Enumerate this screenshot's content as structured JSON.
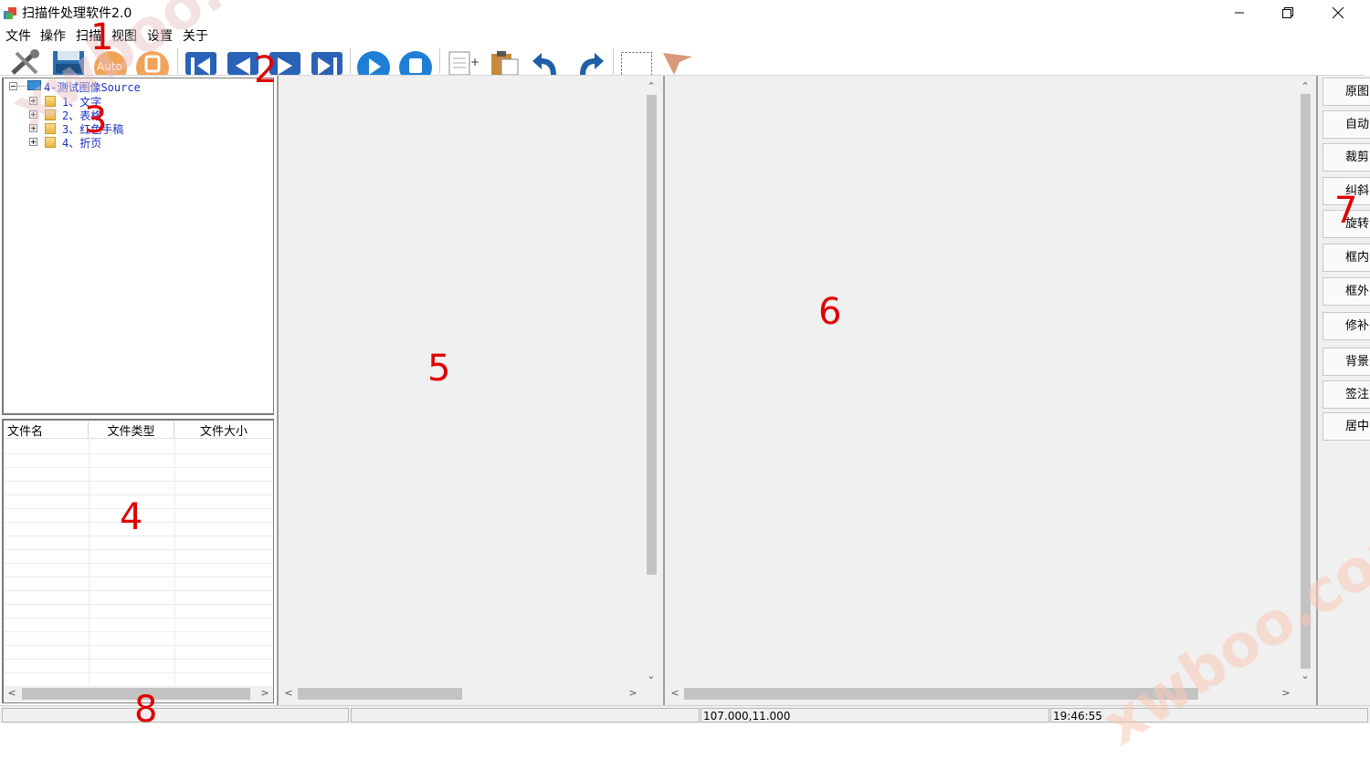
{
  "window": {
    "title": "扫描件处理软件2.0"
  },
  "menu": [
    "文件",
    "操作",
    "扫描",
    "视图",
    "设置",
    "关于"
  ],
  "toolbar": {
    "auto_label": "Auto",
    "icons": [
      "settings-tools-icon",
      "save-floppy-icon",
      "auto-icon",
      "stop-circle-icon",
      "first-page-icon",
      "prev-page-icon",
      "next-page-icon",
      "last-page-icon",
      "play-icon",
      "stop-icon",
      "new-document-icon",
      "paste-icon",
      "undo-icon",
      "redo-icon",
      "select-rect-icon",
      "pointer-icon"
    ]
  },
  "tree": {
    "root": "4-测试图像Source",
    "children": [
      "1、文字",
      "2、表格",
      "3、红色手稿",
      "4、折页"
    ]
  },
  "file_list": {
    "columns": [
      "文件名",
      "文件类型",
      "文件大小"
    ]
  },
  "side_buttons": [
    "原图",
    "自动",
    "裁剪",
    "纠斜",
    "旋转",
    "框内",
    "框外",
    "修补",
    "背景",
    "签注",
    "居中"
  ],
  "status": {
    "coords": "107.000,11.000",
    "time": "19:46:55"
  },
  "annotations": [
    "1",
    "2",
    "3",
    "4",
    "5",
    "6",
    "7",
    "8"
  ],
  "watermark": {
    "text": "xwboo.com"
  },
  "colors": {
    "annotation": "#e00000",
    "tree_text": "#1a30c8",
    "pane_bg": "#f0f0f0"
  }
}
